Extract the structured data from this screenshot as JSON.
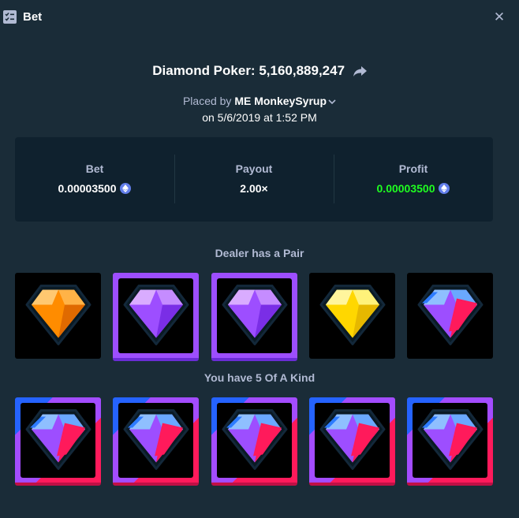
{
  "window": {
    "title": "Bet",
    "close_icon": "close-icon"
  },
  "game": {
    "name_line": "Diamond Poker: 5,160,889,247"
  },
  "placed": {
    "prefix": "Placed by",
    "badge": "ME",
    "user": "MonkeySyrup",
    "date": "on 5/6/2019 at 1:52 PM"
  },
  "stats": {
    "bet_label": "Bet",
    "bet_value": "0.00003500",
    "payout_label": "Payout",
    "payout_value": "2.00×",
    "profit_label": "Profit",
    "profit_value": "0.00003500",
    "profit_color": "#1fff20",
    "currency_icon": "eth-icon"
  },
  "dealer": {
    "title": "Dealer has a Pair",
    "gems": [
      "orange",
      "purple",
      "purple",
      "yellow",
      "blue-red"
    ],
    "highlighted": [
      false,
      true,
      true,
      false,
      false
    ]
  },
  "player": {
    "title": "You have 5 Of A Kind",
    "gems": [
      "blue-red",
      "blue-red",
      "blue-red",
      "blue-red",
      "blue-red"
    ],
    "highlighted": [
      true,
      true,
      true,
      true,
      true
    ]
  },
  "colors": {
    "background": "#1a2c38",
    "panel": "#0f212e",
    "muted_text": "#b1bad3",
    "highlight_purple": "#9d4eff"
  }
}
